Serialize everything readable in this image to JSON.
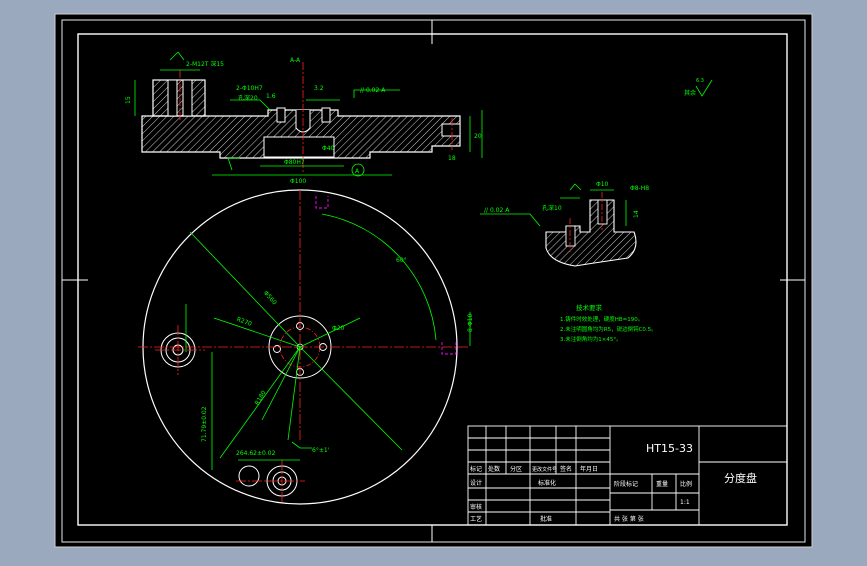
{
  "drawing": {
    "background_color": "#000000",
    "line_color": "#ffffff",
    "center_line_color": "#ff2020",
    "dimension_color": "#00ff00",
    "hidden_line_color": "#ff00ff",
    "frame_outer_color": "#c8c8c8"
  },
  "title_block": {
    "material": "HT15-33",
    "part_name": "分度盘",
    "headers": [
      "标记",
      "处数",
      "分区",
      "更改文件号",
      "签名",
      "年月日"
    ],
    "design": "设计",
    "standardization": "标准化",
    "review": "审核",
    "process": "工艺",
    "approve": "批准",
    "stage_mark": "阶段标记",
    "weight": "重量",
    "scale": "比例",
    "scale_value": "1:1",
    "sheet_info": "共 张 第 张"
  },
  "roughness_note": {
    "label": "其余",
    "value": "6.3"
  },
  "tech_requirements": {
    "title": "技术要求",
    "lines": [
      "1.铸件时效处理，硬度HB=190。",
      "2.未注明圆角均为R5，锐边倒钝C0.5。",
      "3.未注倒角均为1×45°。"
    ]
  },
  "dimensions": {
    "thread_top": "2-M12T 深15",
    "counterbore": "2-Φ10H7",
    "counterbore_depth": "孔深20",
    "parallel_frame": "// 0.02 A",
    "flatness": "0.02",
    "height_15": "15",
    "height_20": "20",
    "height_10": "10",
    "height_18": "18",
    "dia_80": "Φ80H7",
    "dia_100": "Φ100",
    "dia_40": "Φ40",
    "datum_a": "A",
    "angle_60": "60°",
    "dia_560": "Φ560",
    "dia_20": "Φ20",
    "r_270": "R270",
    "dim_8h10": "8-Φ10",
    "r_180": "R180",
    "pos_180": "71.79±0.02",
    "pos_264": "264.62±0.02",
    "pos_145": "145.91±0.02",
    "angle_tol": "6°±1'",
    "sect_dia": "Φ10",
    "sect_depth": "Φ8-H8",
    "sect_14": "14",
    "sect_parallel": "// 0.02 A",
    "sect_depth_label": "孔深10",
    "top_note": "A-A",
    "roughness_top": "1.6",
    "roughness_mid": "3.2"
  }
}
